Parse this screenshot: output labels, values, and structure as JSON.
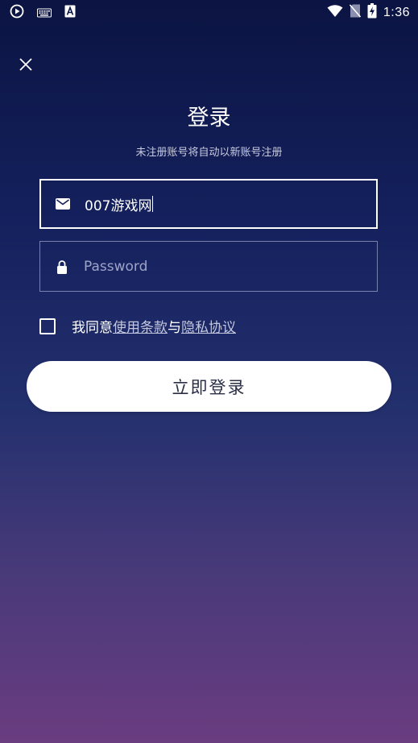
{
  "status_bar": {
    "time": "1:36",
    "icons_left": [
      "play-circle-icon",
      "keyboard-icon",
      "a-font-icon"
    ],
    "icons_right": [
      "wifi-icon",
      "no-sim-icon",
      "battery-charging-icon"
    ]
  },
  "header": {
    "title": "登录",
    "subtitle": "未注册账号将自动以新账号注册"
  },
  "form": {
    "email_value": "007游戏网",
    "password_placeholder": "Password"
  },
  "agreement": {
    "prefix": "我同意",
    "terms_link": "使用条款",
    "conjunction": "与",
    "privacy_link": "隐私协议",
    "checked": false
  },
  "actions": {
    "login_label": "立即登录"
  },
  "colors": {
    "bg_top": "#0b1442",
    "bg_bottom": "#6a3c80",
    "button_bg": "#ffffff",
    "button_text": "#2b2f45"
  }
}
